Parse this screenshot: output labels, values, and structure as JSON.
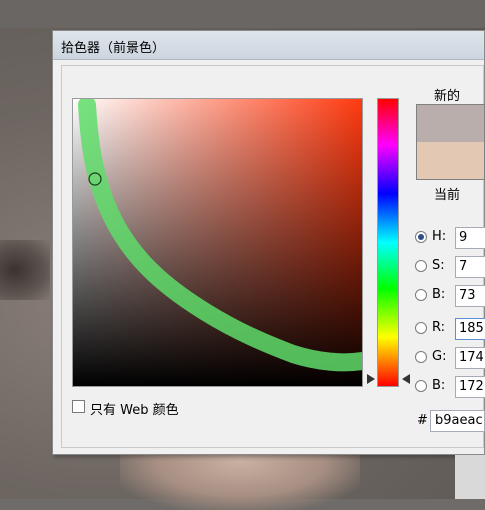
{
  "dialog": {
    "title": "拾色器（前景色）"
  },
  "swatches": {
    "new_label": "新的",
    "current_label": "当前",
    "new_color": "#b9aeac",
    "current_color": "#e3c8b3"
  },
  "fields": [
    {
      "label": "H:",
      "value": "9",
      "selected": true
    },
    {
      "label": "S:",
      "value": "7",
      "selected": false
    },
    {
      "label": "B:",
      "value": "73",
      "selected": false
    },
    {
      "label": "R:",
      "value": "185",
      "selected": false
    },
    {
      "label": "G:",
      "value": "174",
      "selected": false
    },
    {
      "label": "B:",
      "value": "172",
      "selected": false
    }
  ],
  "hex": {
    "hash": "#",
    "value": "b9aeac"
  },
  "web_colors": {
    "label": "只有 Web 颜色",
    "checked": false
  },
  "colors": {
    "hue_base": "#ff3a10",
    "overlay_stroke": "#5fdc6a"
  }
}
